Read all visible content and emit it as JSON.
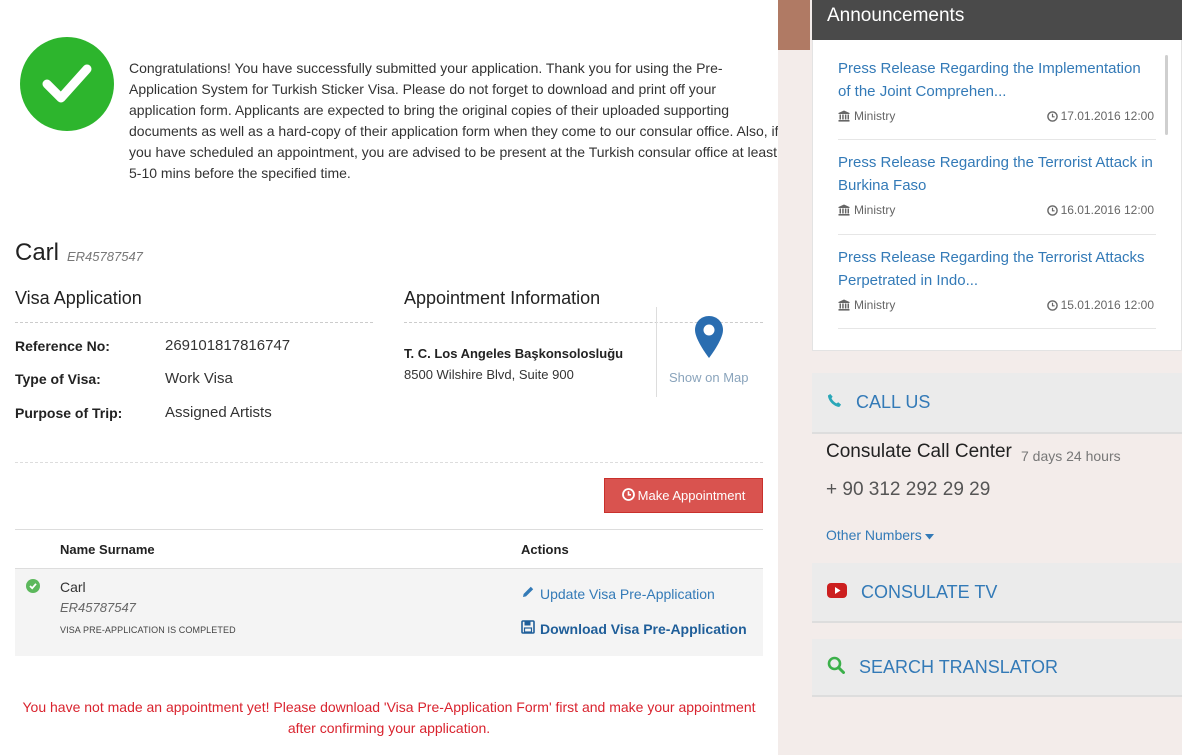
{
  "success": {
    "message": "Congratulations! You have successfully submitted your application. Thank you for using the Pre-Application System for Turkish Sticker Visa. Please do not forget to download and print off your application form. Applicants are expected to bring the original copies of their uploaded supporting documents as well as a hard-copy of their application form when they come to our consular office. Also, if you have scheduled an appointment, you are advised to be present at the Turkish consular office at least 5-10 mins before the specified time."
  },
  "applicant": {
    "name": "Carl",
    "reference": "ER45787547"
  },
  "visa_application": {
    "title": "Visa Application",
    "fields": [
      {
        "label": "Reference No:",
        "value": "269101817816747"
      },
      {
        "label": "Type of Visa:",
        "value": "Work Visa"
      },
      {
        "label": "Purpose of Trip:",
        "value": "Assigned Artists"
      }
    ]
  },
  "appointment_info": {
    "title": "Appointment Information",
    "consulate_name": "T. C. Los Angeles Başkonsolosluğu",
    "consulate_address": "8500 Wilshire Blvd, Suite 900",
    "map_label": "Show on Map"
  },
  "make_appointment_label": "Make Appointment",
  "table": {
    "headers": {
      "name": "Name Surname",
      "actions": "Actions"
    },
    "row": {
      "name": "Carl",
      "reference": "ER45787547",
      "status": "VISA PRE-APPLICATION IS COMPLETED",
      "update_label": "Update Visa Pre-Application",
      "download_label": "Download Visa Pre-Application"
    }
  },
  "warning": "You have not made an appointment yet! Please download 'Visa Pre-Application Form' first and make your appointment after confirming your application.",
  "sidebar": {
    "announcements_title": "Announcements",
    "announcements": [
      {
        "title": "Press Release Regarding the Implementation of the Joint Comprehen...",
        "source": "Ministry",
        "date": "17.01.2016 12:00"
      },
      {
        "title": "Press Release Regarding the Terrorist Attack in Burkina Faso",
        "source": "Ministry",
        "date": "16.01.2016 12:00"
      },
      {
        "title": "Press Release Regarding the Terrorist Attacks Perpetrated in Indo...",
        "source": "Ministry",
        "date": "15.01.2016 12:00"
      }
    ],
    "call_us_label": "CALL US",
    "call_center_title": "Consulate Call Center",
    "call_center_hours": "7 days 24 hours",
    "call_center_number": "+ 90 312 292 29 29",
    "other_numbers_label": "Other Numbers",
    "consulate_tv_label": "CONSULATE TV",
    "search_translator_label": "SEARCH TRANSLATOR"
  },
  "colors": {
    "success_green": "#2db52d",
    "danger_red": "#d9534f",
    "link_blue": "#337ab7",
    "warning_red": "#d9232e"
  }
}
